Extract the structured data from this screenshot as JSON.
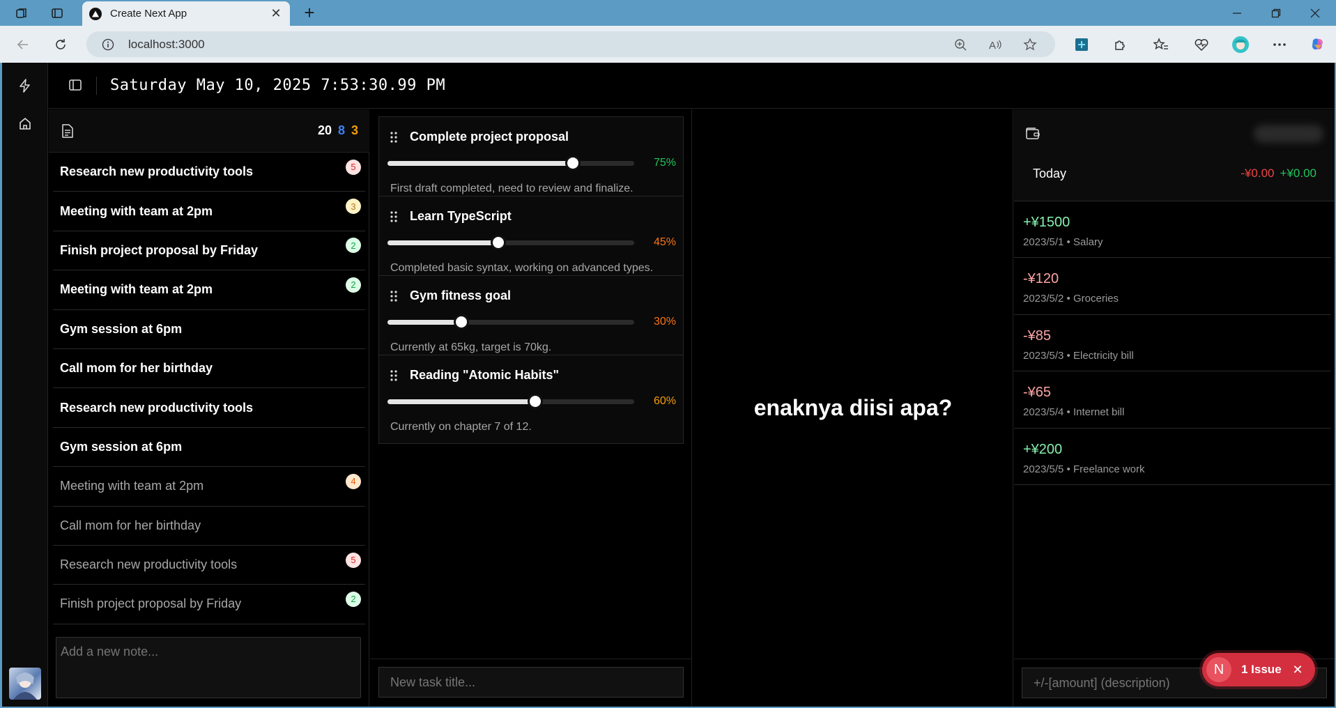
{
  "browser": {
    "tab_title": "Create Next App",
    "url": "localhost:3000"
  },
  "header": {
    "clock": "Saturday May 10, 2025 7:53:30.99 PM"
  },
  "notes": {
    "counts": [
      "20",
      "8",
      "3"
    ],
    "items": [
      {
        "text": "Research new productivity tools",
        "badge": "5",
        "style": "bold",
        "badge_color": "red"
      },
      {
        "text": "Meeting with team at 2pm",
        "badge": "3",
        "style": "bold",
        "badge_color": "yellow"
      },
      {
        "text": "Finish project proposal by Friday",
        "badge": "2",
        "style": "bold",
        "badge_color": "green"
      },
      {
        "text": "Meeting with team at 2pm",
        "badge": "2",
        "style": "bold",
        "badge_color": "green"
      },
      {
        "text": "Gym session at 6pm",
        "badge": "",
        "style": "bold",
        "badge_color": ""
      },
      {
        "text": "Call mom for her birthday",
        "badge": "",
        "style": "bold",
        "badge_color": ""
      },
      {
        "text": "Research new productivity tools",
        "badge": "",
        "style": "bold",
        "badge_color": ""
      },
      {
        "text": "Gym session at 6pm",
        "badge": "",
        "style": "bold",
        "badge_color": ""
      },
      {
        "text": "Meeting with team at 2pm",
        "badge": "4",
        "style": "dim",
        "badge_color": "orange"
      },
      {
        "text": "Call mom for her birthday",
        "badge": "",
        "style": "dim",
        "badge_color": ""
      },
      {
        "text": "Research new productivity tools",
        "badge": "5",
        "style": "dim",
        "badge_color": "red"
      },
      {
        "text": "Finish project proposal by Friday",
        "badge": "2",
        "style": "dim",
        "badge_color": "green"
      }
    ],
    "input_placeholder": "Add a new note..."
  },
  "goals": {
    "items": [
      {
        "title": "Complete project proposal",
        "progress": 75,
        "pct_label": "75%",
        "pct_color": "#22c55e",
        "desc": "First draft completed, need to review and finalize."
      },
      {
        "title": "Learn TypeScript",
        "progress": 45,
        "pct_label": "45%",
        "pct_color": "#f97316",
        "desc": "Completed basic syntax, working on advanced types."
      },
      {
        "title": "Gym fitness goal",
        "progress": 30,
        "pct_label": "30%",
        "pct_color": "#f97316",
        "desc": "Currently at 65kg, target is 70kg."
      },
      {
        "title": "Reading \"Atomic Habits\"",
        "progress": 60,
        "pct_label": "60%",
        "pct_color": "#f59e0b",
        "desc": "Currently on chapter 7 of 12."
      }
    ],
    "input_placeholder": "New task title..."
  },
  "middle": {
    "message": "enaknya diisi apa?"
  },
  "finance": {
    "today_label": "Today",
    "today_expense": "-¥0.00",
    "today_income": "+¥0.00",
    "transactions": [
      {
        "amount": "+¥1500",
        "sign": "plus",
        "meta": "2023/5/1 • Salary"
      },
      {
        "amount": "-¥120",
        "sign": "minus",
        "meta": "2023/5/2 • Groceries"
      },
      {
        "amount": "-¥85",
        "sign": "minus",
        "meta": "2023/5/3 • Electricity bill"
      },
      {
        "amount": "-¥65",
        "sign": "minus",
        "meta": "2023/5/4 • Internet bill"
      },
      {
        "amount": "+¥200",
        "sign": "plus",
        "meta": "2023/5/5 • Freelance work"
      }
    ],
    "input_placeholder": "+/-[amount] (description)"
  },
  "issue_badge": {
    "letter": "N",
    "label": "1 Issue"
  }
}
